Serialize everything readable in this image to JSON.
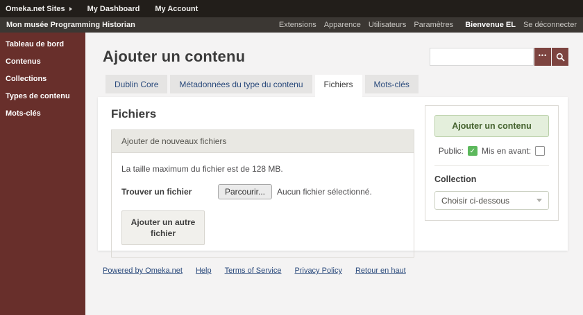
{
  "topbar": {
    "items": [
      {
        "label": "Omeka.net Sites"
      },
      {
        "label": "My Dashboard"
      },
      {
        "label": "My Account"
      }
    ]
  },
  "navbar": {
    "site_title": "Mon musée Programming Historian",
    "links": [
      {
        "label": "Extensions"
      },
      {
        "label": "Apparence"
      },
      {
        "label": "Utilisateurs"
      },
      {
        "label": "Paramètres"
      }
    ],
    "welcome": "Bienvenue EL",
    "logout": "Se déconnecter"
  },
  "sidebar": {
    "items": [
      {
        "label": "Tableau de bord"
      },
      {
        "label": "Contenus"
      },
      {
        "label": "Collections"
      },
      {
        "label": "Types de contenu"
      },
      {
        "label": "Mots-clés"
      }
    ]
  },
  "header": {
    "title": "Ajouter un contenu",
    "search": {
      "value": ""
    }
  },
  "tabs": [
    {
      "label": "Dublin Core",
      "active": false
    },
    {
      "label": "Métadonnées du type du contenu",
      "active": false
    },
    {
      "label": "Fichiers",
      "active": true
    },
    {
      "label": "Mots-clés",
      "active": false
    }
  ],
  "content": {
    "section_title": "Fichiers",
    "box_header": "Ajouter de nouveaux fichiers",
    "max_size_text": "La taille maximum du fichier est de 128 MB.",
    "find_file_label": "Trouver un fichier",
    "browse_button_label": "Parcourir...",
    "no_file_text": "Aucun fichier sélectionné.",
    "add_another_button_label": "Ajouter un autre fichier"
  },
  "side_panel": {
    "submit_button_label": "Ajouter un contenu",
    "public_label": "Public:",
    "public_checked": true,
    "featured_label": "Mis en avant:",
    "featured_checked": false,
    "collection_label": "Collection",
    "collection_value": "Choisir ci-dessous"
  },
  "footer": {
    "links": [
      {
        "label": "Powered by Omeka.net"
      },
      {
        "label": "Help"
      },
      {
        "label": "Terms of Service"
      },
      {
        "label": "Privacy Policy"
      },
      {
        "label": "Retour en haut"
      }
    ]
  },
  "icons": {
    "more_options": "•••",
    "checkmark": "✓",
    "search": "magnifier",
    "caret_right": "triangle-right",
    "chevron_down": "triangle-down"
  },
  "colors": {
    "sidebar_maroon": "#682f2b",
    "button_maroon": "#7d4440",
    "topbar_dark": "#221e1a",
    "navbar_dark": "#3b3733",
    "tab_link_navy": "#2a4a7c",
    "green_button_bg": "#e4efdc",
    "green_button_text": "#45632f",
    "checkbox_green": "#5cb85c",
    "page_bg": "#f4f3f3"
  }
}
